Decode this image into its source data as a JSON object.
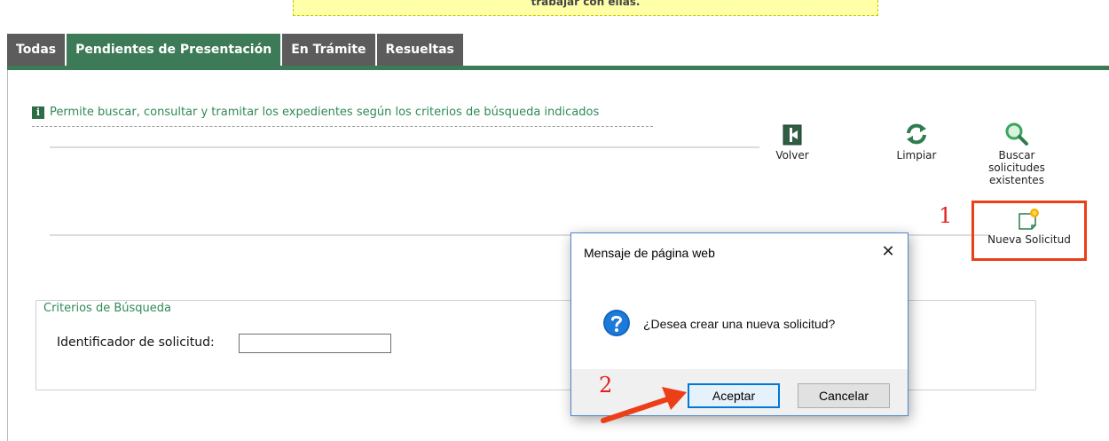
{
  "top_notice": "trabajar con ellas.",
  "tabs": [
    {
      "label": "Todas"
    },
    {
      "label": "Pendientes de Presentación"
    },
    {
      "label": "En Trámite"
    },
    {
      "label": "Resueltas"
    }
  ],
  "info": {
    "text": "Permite buscar, consultar y tramitar los expedientes según los criterios de búsqueda indicados",
    "icon": "info-icon"
  },
  "actions": {
    "volver": "Volver",
    "limpiar": "Limpiar",
    "buscar": "Buscar solicitudes existentes",
    "nueva": "Nueva Solicitud"
  },
  "annotations": {
    "step1": "1",
    "step2": "2",
    "highlight_color": "#ec3e17"
  },
  "search": {
    "legend": "Criterios de Búsqueda",
    "id_label": "Identificador de solicitud:",
    "id_value": ""
  },
  "dialog": {
    "title": "Mensaje de página web",
    "close_symbol": "✕",
    "message": "¿Desea crear una nueva solicitud?",
    "ok_label": "Aceptar",
    "cancel_label": "Cancelar"
  },
  "colors": {
    "brand_green": "#3d7a57",
    "tab_gray": "#5c5c5c",
    "link_green": "#2e8a55"
  }
}
